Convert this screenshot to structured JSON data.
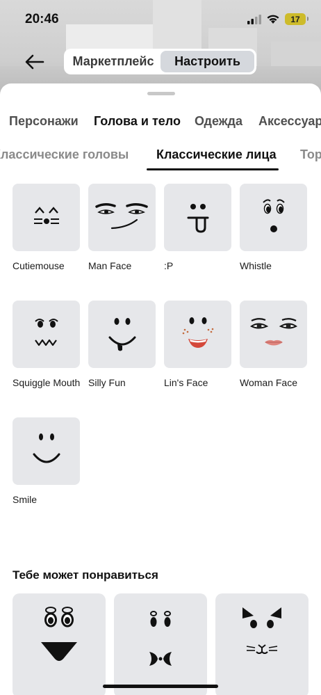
{
  "status": {
    "time": "20:46",
    "battery": "17"
  },
  "nav": {
    "tabs": [
      {
        "label": "Маркетплейс"
      },
      {
        "label": "Настроить"
      }
    ]
  },
  "categories": [
    {
      "label": "Персонажи"
    },
    {
      "label": "Голова и тело"
    },
    {
      "label": "Одежда"
    },
    {
      "label": "Аксессуары"
    }
  ],
  "subcategories": [
    {
      "label": "Классические головы"
    },
    {
      "label": "Классические лица"
    },
    {
      "label": "Торсы"
    }
  ],
  "faces": [
    {
      "label": "Cutiemouse"
    },
    {
      "label": "Man Face"
    },
    {
      "label": ":P"
    },
    {
      "label": "Whistle"
    },
    {
      "label": "Squiggle Mouth"
    },
    {
      "label": "Silly Fun"
    },
    {
      "label": "Lin's Face"
    },
    {
      "label": "Woman Face"
    },
    {
      "label": "Smile"
    }
  ],
  "recommended": {
    "title": "Тебе может понравиться"
  }
}
